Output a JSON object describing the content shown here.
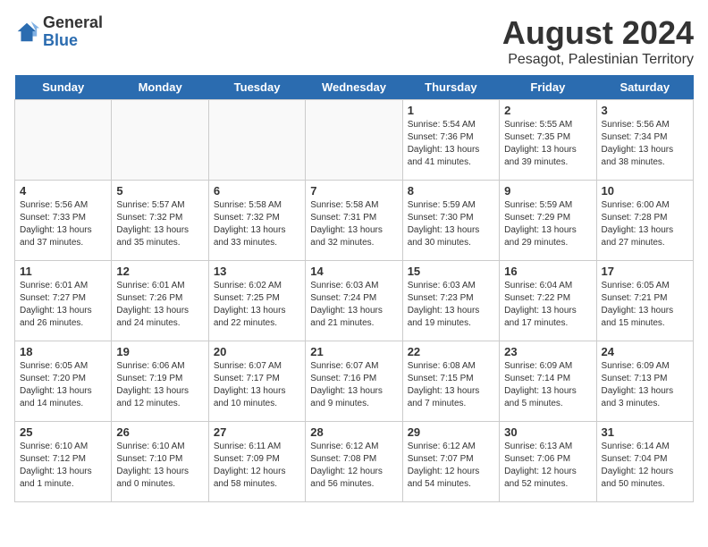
{
  "header": {
    "logo_general": "General",
    "logo_blue": "Blue",
    "title": "August 2024",
    "subtitle": "Pesagot, Palestinian Territory"
  },
  "days_of_week": [
    "Sunday",
    "Monday",
    "Tuesday",
    "Wednesday",
    "Thursday",
    "Friday",
    "Saturday"
  ],
  "weeks": [
    [
      {
        "day": "",
        "text": ""
      },
      {
        "day": "",
        "text": ""
      },
      {
        "day": "",
        "text": ""
      },
      {
        "day": "",
        "text": ""
      },
      {
        "day": "1",
        "text": "Sunrise: 5:54 AM\nSunset: 7:36 PM\nDaylight: 13 hours\nand 41 minutes."
      },
      {
        "day": "2",
        "text": "Sunrise: 5:55 AM\nSunset: 7:35 PM\nDaylight: 13 hours\nand 39 minutes."
      },
      {
        "day": "3",
        "text": "Sunrise: 5:56 AM\nSunset: 7:34 PM\nDaylight: 13 hours\nand 38 minutes."
      }
    ],
    [
      {
        "day": "4",
        "text": "Sunrise: 5:56 AM\nSunset: 7:33 PM\nDaylight: 13 hours\nand 37 minutes."
      },
      {
        "day": "5",
        "text": "Sunrise: 5:57 AM\nSunset: 7:32 PM\nDaylight: 13 hours\nand 35 minutes."
      },
      {
        "day": "6",
        "text": "Sunrise: 5:58 AM\nSunset: 7:32 PM\nDaylight: 13 hours\nand 33 minutes."
      },
      {
        "day": "7",
        "text": "Sunrise: 5:58 AM\nSunset: 7:31 PM\nDaylight: 13 hours\nand 32 minutes."
      },
      {
        "day": "8",
        "text": "Sunrise: 5:59 AM\nSunset: 7:30 PM\nDaylight: 13 hours\nand 30 minutes."
      },
      {
        "day": "9",
        "text": "Sunrise: 5:59 AM\nSunset: 7:29 PM\nDaylight: 13 hours\nand 29 minutes."
      },
      {
        "day": "10",
        "text": "Sunrise: 6:00 AM\nSunset: 7:28 PM\nDaylight: 13 hours\nand 27 minutes."
      }
    ],
    [
      {
        "day": "11",
        "text": "Sunrise: 6:01 AM\nSunset: 7:27 PM\nDaylight: 13 hours\nand 26 minutes."
      },
      {
        "day": "12",
        "text": "Sunrise: 6:01 AM\nSunset: 7:26 PM\nDaylight: 13 hours\nand 24 minutes."
      },
      {
        "day": "13",
        "text": "Sunrise: 6:02 AM\nSunset: 7:25 PM\nDaylight: 13 hours\nand 22 minutes."
      },
      {
        "day": "14",
        "text": "Sunrise: 6:03 AM\nSunset: 7:24 PM\nDaylight: 13 hours\nand 21 minutes."
      },
      {
        "day": "15",
        "text": "Sunrise: 6:03 AM\nSunset: 7:23 PM\nDaylight: 13 hours\nand 19 minutes."
      },
      {
        "day": "16",
        "text": "Sunrise: 6:04 AM\nSunset: 7:22 PM\nDaylight: 13 hours\nand 17 minutes."
      },
      {
        "day": "17",
        "text": "Sunrise: 6:05 AM\nSunset: 7:21 PM\nDaylight: 13 hours\nand 15 minutes."
      }
    ],
    [
      {
        "day": "18",
        "text": "Sunrise: 6:05 AM\nSunset: 7:20 PM\nDaylight: 13 hours\nand 14 minutes."
      },
      {
        "day": "19",
        "text": "Sunrise: 6:06 AM\nSunset: 7:19 PM\nDaylight: 13 hours\nand 12 minutes."
      },
      {
        "day": "20",
        "text": "Sunrise: 6:07 AM\nSunset: 7:17 PM\nDaylight: 13 hours\nand 10 minutes."
      },
      {
        "day": "21",
        "text": "Sunrise: 6:07 AM\nSunset: 7:16 PM\nDaylight: 13 hours\nand 9 minutes."
      },
      {
        "day": "22",
        "text": "Sunrise: 6:08 AM\nSunset: 7:15 PM\nDaylight: 13 hours\nand 7 minutes."
      },
      {
        "day": "23",
        "text": "Sunrise: 6:09 AM\nSunset: 7:14 PM\nDaylight: 13 hours\nand 5 minutes."
      },
      {
        "day": "24",
        "text": "Sunrise: 6:09 AM\nSunset: 7:13 PM\nDaylight: 13 hours\nand 3 minutes."
      }
    ],
    [
      {
        "day": "25",
        "text": "Sunrise: 6:10 AM\nSunset: 7:12 PM\nDaylight: 13 hours\nand 1 minute."
      },
      {
        "day": "26",
        "text": "Sunrise: 6:10 AM\nSunset: 7:10 PM\nDaylight: 13 hours\nand 0 minutes."
      },
      {
        "day": "27",
        "text": "Sunrise: 6:11 AM\nSunset: 7:09 PM\nDaylight: 12 hours\nand 58 minutes."
      },
      {
        "day": "28",
        "text": "Sunrise: 6:12 AM\nSunset: 7:08 PM\nDaylight: 12 hours\nand 56 minutes."
      },
      {
        "day": "29",
        "text": "Sunrise: 6:12 AM\nSunset: 7:07 PM\nDaylight: 12 hours\nand 54 minutes."
      },
      {
        "day": "30",
        "text": "Sunrise: 6:13 AM\nSunset: 7:06 PM\nDaylight: 12 hours\nand 52 minutes."
      },
      {
        "day": "31",
        "text": "Sunrise: 6:14 AM\nSunset: 7:04 PM\nDaylight: 12 hours\nand 50 minutes."
      }
    ]
  ]
}
